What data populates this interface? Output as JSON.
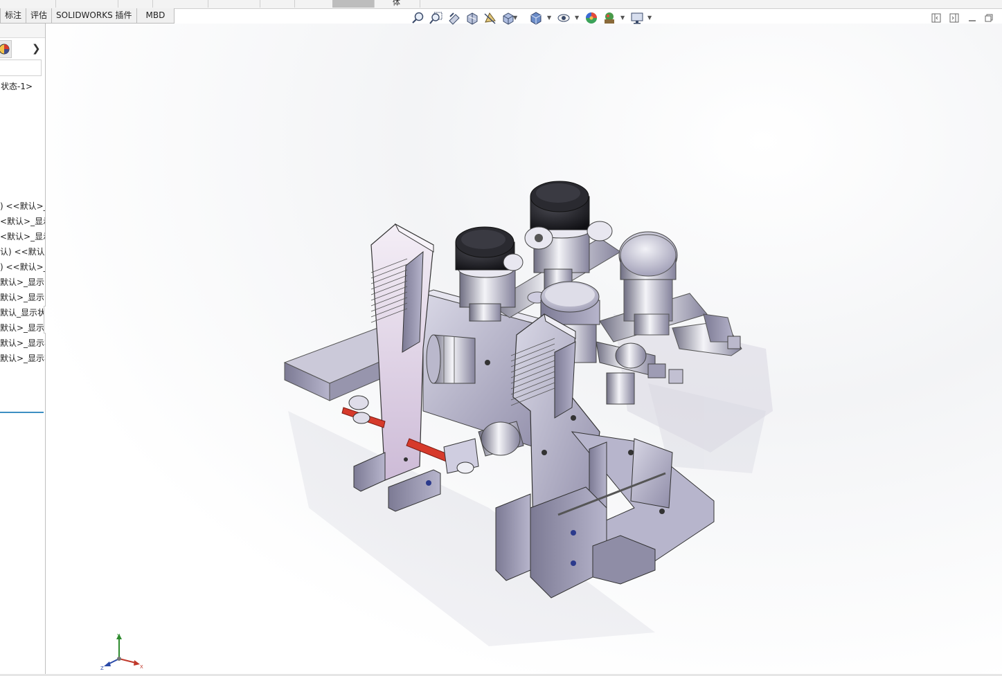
{
  "top_strip": {
    "partial_label": "体"
  },
  "tabs": [
    {
      "label": "标注"
    },
    {
      "label": "评估"
    },
    {
      "label": "SOLIDWORKS 插件"
    },
    {
      "label": "MBD"
    }
  ],
  "feature_manager": {
    "config_label": "状态-1>",
    "tree_items": [
      ") <<默认>_",
      "<默认>_显示",
      "<默认>_显示",
      "认) <<默认",
      ") <<默认>_",
      "默认>_显示",
      "默认>_显示",
      "默认_显示状",
      "默认>_显示状",
      "默认>_显示状",
      "默认>_显示状"
    ]
  },
  "heads_up_toolbar": [
    "zoom-to-fit-icon",
    "zoom-to-area-icon",
    "previous-view-icon",
    "section-view-icon",
    "dynamic-annotation-icon",
    "view-orientation-icon",
    "display-style-icon",
    "hide-show-items-icon",
    "edit-appearance-icon",
    "apply-scene-icon",
    "view-settings-icon"
  ],
  "triad": {
    "x": "X",
    "y": "Y",
    "z": "Z"
  },
  "colors": {
    "accent": "#3c8fc2",
    "part_metal": "#a8a6c0",
    "knob": "#1e1e22",
    "red_part": "#d63a2b"
  }
}
